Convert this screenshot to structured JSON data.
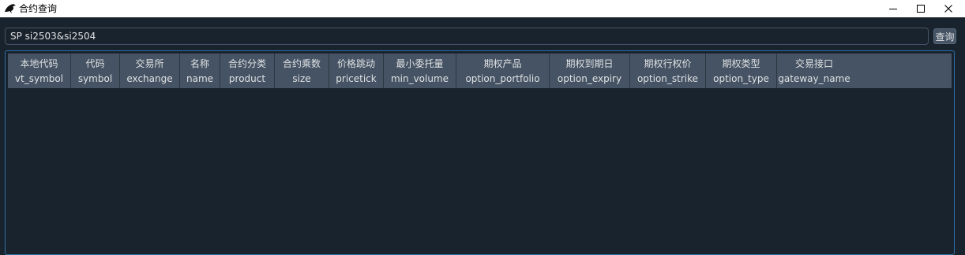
{
  "window": {
    "title": "合约查询"
  },
  "search": {
    "value": "SP si2503&si2504"
  },
  "toolbar": {
    "query_label": "查询"
  },
  "table": {
    "columns": [
      {
        "cn": "本地代码",
        "en": "vt_symbol"
      },
      {
        "cn": "代码",
        "en": "symbol"
      },
      {
        "cn": "交易所",
        "en": "exchange"
      },
      {
        "cn": "名称",
        "en": "name"
      },
      {
        "cn": "合约分类",
        "en": "product"
      },
      {
        "cn": "合约乘数",
        "en": "size"
      },
      {
        "cn": "价格跳动",
        "en": "pricetick"
      },
      {
        "cn": "最小委托量",
        "en": "min_volume"
      },
      {
        "cn": "期权产品",
        "en": "option_portfolio"
      },
      {
        "cn": "期权到期日",
        "en": "option_expiry"
      },
      {
        "cn": "期权行权价",
        "en": "option_strike"
      },
      {
        "cn": "期权类型",
        "en": "option_type"
      },
      {
        "cn": "交易接口",
        "en": "gateway_name"
      }
    ],
    "rows": []
  },
  "colors": {
    "background": "#19232d",
    "header": "#455364",
    "text": "#e0e1e3",
    "frame_border": "#2d6ea6"
  }
}
